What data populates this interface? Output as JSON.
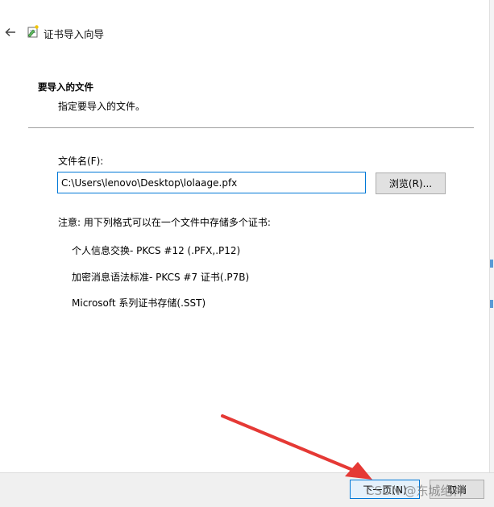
{
  "window": {
    "title": "证书导入向导",
    "back_icon": "arrow-left-icon",
    "wizard_icon": "certificate-wizard-icon"
  },
  "section": {
    "title": "要导入的文件",
    "subtitle": "指定要导入的文件。"
  },
  "file": {
    "label": "文件名(F):",
    "value": "C:\\Users\\lenovo\\Desktop\\lolaage.pfx",
    "browse_label": "浏览(R)..."
  },
  "note": {
    "text": "注意: 用下列格式可以在一个文件中存储多个证书:",
    "formats": [
      "个人信息交换- PKCS #12 (.PFX,.P12)",
      "加密消息语法标准- PKCS #7 证书(.P7B)",
      "Microsoft 系列证书存储(.SST)"
    ]
  },
  "footer": {
    "next_label": "下一页(N)",
    "cancel_label": "取消"
  },
  "watermark": "CSDN @东城绝神",
  "colors": {
    "accent": "#0078d7",
    "annotation_arrow": "#e53935"
  }
}
